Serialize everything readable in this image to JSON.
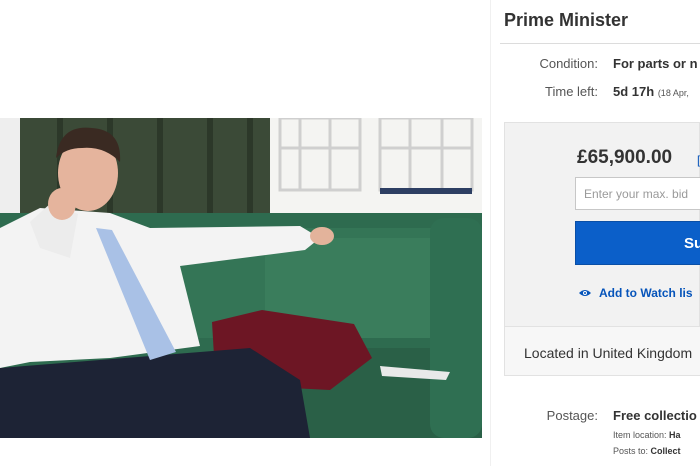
{
  "listing": {
    "title": "Prime Minister",
    "condition_label": "Condition:",
    "condition_value": "For parts or n",
    "time_left_label": "Time left:",
    "time_left_value": "5d 17h",
    "time_left_date": "(18 Apr,"
  },
  "buy": {
    "price": "£65,900.00",
    "price_tail": "[",
    "bid_placeholder": "Enter your max. bid",
    "submit_label": "Su",
    "watch_label": "Add to Watch lis",
    "location": "Located in United Kingdom"
  },
  "shipping": {
    "postage_label": "Postage:",
    "postage_value": "Free collectio",
    "item_location_label": "Item location:",
    "item_location_value": "Ha",
    "posts_to_label": "Posts to:",
    "posts_to_value": "Collect"
  },
  "colors": {
    "accent": "#0654ba",
    "button": "#0b5fc9",
    "sofa": "#2e6b4f"
  },
  "icons": {
    "watch": "eye-icon"
  }
}
